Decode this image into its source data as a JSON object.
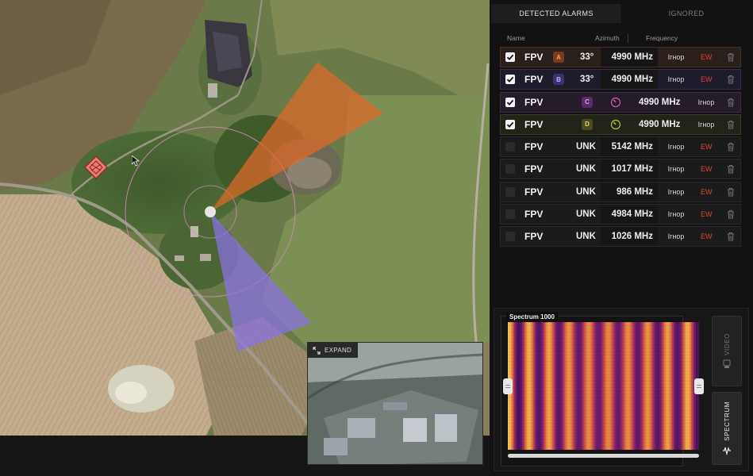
{
  "map": {
    "expand_label": "EXPAND"
  },
  "tabs": [
    {
      "label": "DETECTED ALARMS",
      "active": true
    },
    {
      "label": "IGNORED",
      "active": false
    }
  ],
  "columns": {
    "name": "Name",
    "azimuth": "Azimuth",
    "frequency": "Frequency"
  },
  "alarms": [
    {
      "type": "FPV",
      "letter": "A",
      "letter_color": "#7a3b1f",
      "letter_text_color": "#f0a070",
      "azimuth": "33°",
      "frequency": "4990 MHz",
      "ignore": "Ігнор",
      "ew": "EW",
      "checked": true,
      "row_color": "#2a1f1b",
      "row_border": "#4a2f22",
      "compass": false
    },
    {
      "type": "FPV",
      "letter": "B",
      "letter_color": "#3b3370",
      "letter_text_color": "#b8b0ff",
      "azimuth": "33°",
      "frequency": "4990 MHz",
      "ignore": "Ігнор",
      "ew": "EW",
      "checked": true,
      "row_color": "#1e1c2c",
      "row_border": "#332f4d",
      "compass": false
    },
    {
      "type": "FPV",
      "letter": "C",
      "letter_color": "#5a2b66",
      "letter_text_color": "#e2a6f0",
      "azimuth": "",
      "frequency": "4990 MHz",
      "ignore": "Ігнор",
      "ew": "",
      "checked": true,
      "row_color": "#261b29",
      "row_border": "#3f2b45",
      "compass": true,
      "compass_color": "#d25ac8"
    },
    {
      "type": "FPV",
      "letter": "D",
      "letter_color": "#4f4a1e",
      "letter_text_color": "#e2d77a",
      "azimuth": "",
      "frequency": "4990 MHz",
      "ignore": "Ігнор",
      "ew": "",
      "checked": true,
      "row_color": "#22241a",
      "row_border": "#3a3d26",
      "compass": true,
      "compass_color": "#b7c33a"
    },
    {
      "type": "FPV",
      "letter": "",
      "azimuth": "UNK",
      "frequency": "5142 MHz",
      "ignore": "Ігнор",
      "ew": "EW",
      "checked": false
    },
    {
      "type": "FPV",
      "letter": "",
      "azimuth": "UNK",
      "frequency": "1017 MHz",
      "ignore": "Ігнор",
      "ew": "EW",
      "checked": false
    },
    {
      "type": "FPV",
      "letter": "",
      "azimuth": "UNK",
      "frequency": "986 MHz",
      "ignore": "Ігнор",
      "ew": "EW",
      "checked": false
    },
    {
      "type": "FPV",
      "letter": "",
      "azimuth": "UNK",
      "frequency": "4984 MHz",
      "ignore": "Ігнор",
      "ew": "EW",
      "checked": false
    },
    {
      "type": "FPV",
      "letter": "",
      "azimuth": "UNK",
      "frequency": "1026 MHz",
      "ignore": "Ігнор",
      "ew": "EW",
      "checked": false
    }
  ],
  "spectrum": {
    "label": "Spectrum 1000",
    "video_button": "VIDEO",
    "spectrum_button": "SPECTRUM"
  },
  "colors": {
    "sector_orange": "#e0692a",
    "sector_purple": "#8a72e6",
    "ew": "#e0452f",
    "target_marker": "#f07a6e"
  }
}
